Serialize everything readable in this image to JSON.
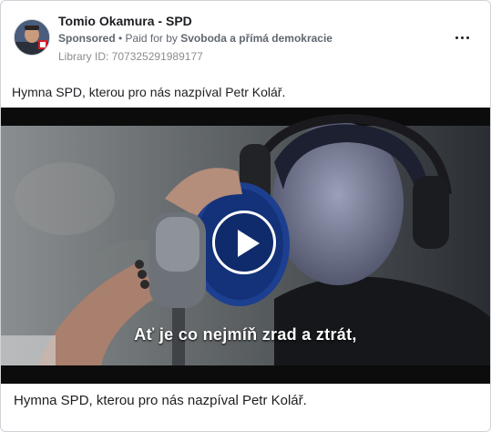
{
  "advertiser": {
    "name": "Tomio Okamura - SPD",
    "sponsored_label": "Sponsored",
    "separator": " • ",
    "paid_for_prefix": "Paid for by ",
    "funder": "Svoboda a přímá demokracie",
    "library_id": "Library ID: 707325291989177"
  },
  "post": {
    "text": "Hymna SPD, kterou pro nás nazpíval Petr Kolář."
  },
  "video": {
    "subtitle": "Ať je co nejmíň zrad a ztrát,",
    "play_label": "play"
  },
  "caption": {
    "text": "Hymna SPD, kterou pro nás nazpíval Petr Kolář."
  },
  "icons": {
    "more": "more-horizontal-icon",
    "play": "play-icon"
  }
}
